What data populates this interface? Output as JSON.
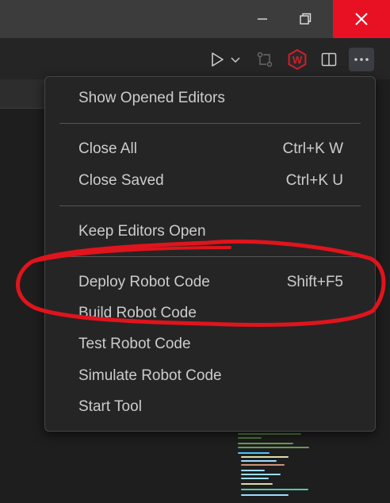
{
  "window": {
    "minimize_icon": "minimize-icon",
    "restore_icon": "restore-icon",
    "close_icon": "close-icon",
    "close_color": "#e81123"
  },
  "toolbar": {
    "run_icon": "run-icon",
    "compare_icon": "compare-changes-icon",
    "wpilib_icon": "wpilib-icon",
    "wpilib_letter": "W",
    "split_icon": "split-editor-icon",
    "more_icon": "more-actions-icon"
  },
  "menu": {
    "items": [
      {
        "label": "Show Opened Editors",
        "shortcut": ""
      },
      {
        "label": "Close All",
        "shortcut": "Ctrl+K W"
      },
      {
        "label": "Close Saved",
        "shortcut": "Ctrl+K U"
      },
      {
        "label": "Keep Editors Open",
        "shortcut": ""
      },
      {
        "label": "Deploy Robot Code",
        "shortcut": "Shift+F5"
      },
      {
        "label": "Build Robot Code",
        "shortcut": ""
      },
      {
        "label": "Test Robot Code",
        "shortcut": ""
      },
      {
        "label": "Simulate Robot Code",
        "shortcut": ""
      },
      {
        "label": "Start Tool",
        "shortcut": ""
      }
    ]
  },
  "colors": {
    "annotation": "#e0141c",
    "menu_text": "#cccccc",
    "menu_bg": "#252526"
  }
}
